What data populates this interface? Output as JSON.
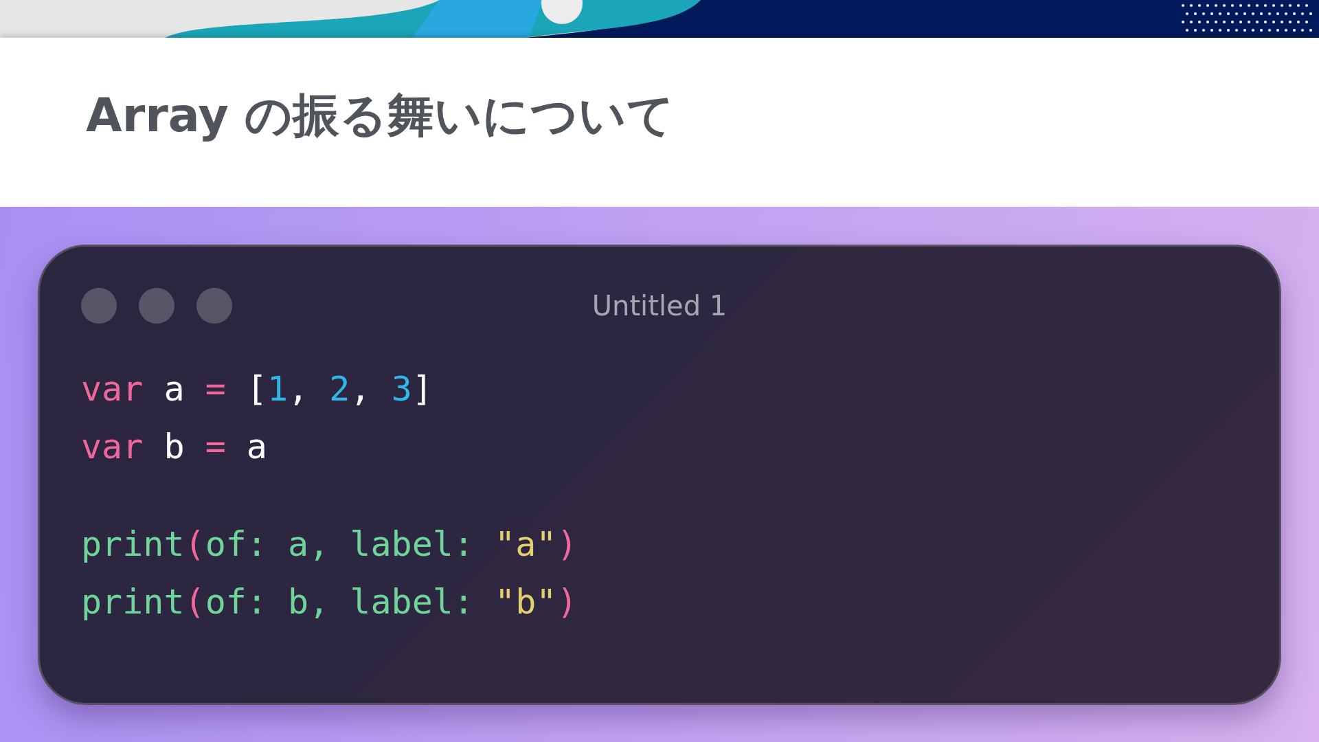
{
  "slide": {
    "title": "Array の振る舞いについて"
  },
  "code_window": {
    "title": "Untitled 1",
    "blocks": [
      [
        [
          {
            "text": "var ",
            "kind": "keyword"
          },
          {
            "text": "a ",
            "kind": "ident"
          },
          {
            "text": "= ",
            "kind": "op"
          },
          {
            "text": "[",
            "kind": "punct"
          },
          {
            "text": "1",
            "kind": "number"
          },
          {
            "text": ", ",
            "kind": "punct"
          },
          {
            "text": "2",
            "kind": "number"
          },
          {
            "text": ", ",
            "kind": "punct"
          },
          {
            "text": "3",
            "kind": "number"
          },
          {
            "text": "]",
            "kind": "punct"
          }
        ],
        [
          {
            "text": "var ",
            "kind": "keyword"
          },
          {
            "text": "b ",
            "kind": "ident"
          },
          {
            "text": "= ",
            "kind": "op"
          },
          {
            "text": "a",
            "kind": "ident"
          }
        ]
      ],
      [
        [
          {
            "text": "print",
            "kind": "func"
          },
          {
            "text": "(",
            "kind": "paren"
          },
          {
            "text": "of: a, label: ",
            "kind": "func"
          },
          {
            "text": "\"a\"",
            "kind": "string"
          },
          {
            "text": ")",
            "kind": "paren"
          }
        ],
        [
          {
            "text": "print",
            "kind": "func"
          },
          {
            "text": "(",
            "kind": "paren"
          },
          {
            "text": "of: b, label: ",
            "kind": "func"
          },
          {
            "text": "\"b\"",
            "kind": "string"
          },
          {
            "text": ")",
            "kind": "paren"
          }
        ]
      ]
    ]
  }
}
